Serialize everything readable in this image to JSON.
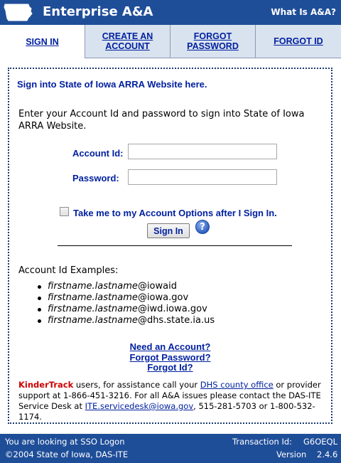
{
  "header": {
    "title": "Enterprise A&A",
    "help_link": "What Is A&A?",
    "logo_icon": "iowa-state-outline-icon"
  },
  "tabs": [
    {
      "label": "SIGN IN",
      "active": true
    },
    {
      "label": "CREATE AN ACCOUNT",
      "active": false
    },
    {
      "label": "FORGOT PASSWORD",
      "active": false
    },
    {
      "label": "FORGOT ID",
      "active": false
    }
  ],
  "form": {
    "title": "Sign into State of Iowa ARRA Website here.",
    "intro": "Enter your Account Id and password to sign into State of Iowa ARRA Website.",
    "account_label": "Account Id:",
    "account_value": "",
    "password_label": "Password:",
    "password_value": "",
    "checkbox_label": "Take me to my Account Options after I Sign In.",
    "checkbox_checked": false,
    "submit_label": "Sign In",
    "help_icon": "question-mark-icon"
  },
  "examples": {
    "title": "Account Id Examples:",
    "items": [
      {
        "name": "firstname.lastname",
        "domain": "@iowaid"
      },
      {
        "name": "firstname.lastname",
        "domain": "@iowa.gov"
      },
      {
        "name": "firstname.lastname",
        "domain": "@iwd.iowa.gov"
      },
      {
        "name": "firstname.lastname",
        "domain": "@dhs.state.ia.us"
      }
    ]
  },
  "links": {
    "need_account": "Need an Account?",
    "forgot_password": "Forgot Password?",
    "forgot_id": "Forgot Id?"
  },
  "support": {
    "kindertrack": "KinderTrack",
    "text1": " users, for assistance call your ",
    "dhs_link": "DHS county office",
    "text2": " or provider support at 1-866-451-3216. For all A&A issues please contact the DAS-ITE Service Desk at ",
    "email_link": "ITE.servicedesk@iowa.gov",
    "text3": ", 515-281-5703 or 1-800-532-1174."
  },
  "status": {
    "looking_at": "You are looking at SSO Logon",
    "copyright": "©2004 State of Iowa, DAS-ITE",
    "transaction_label": "Transaction Id:",
    "transaction_value": "G6OEQL",
    "version_label": "Version",
    "version_value": "2.4.6"
  },
  "colors": {
    "brand_blue": "#1f4e99",
    "link_blue": "#00209f",
    "tab_inactive": "#d9e3ef",
    "kindertrack_red": "#cc0000"
  }
}
